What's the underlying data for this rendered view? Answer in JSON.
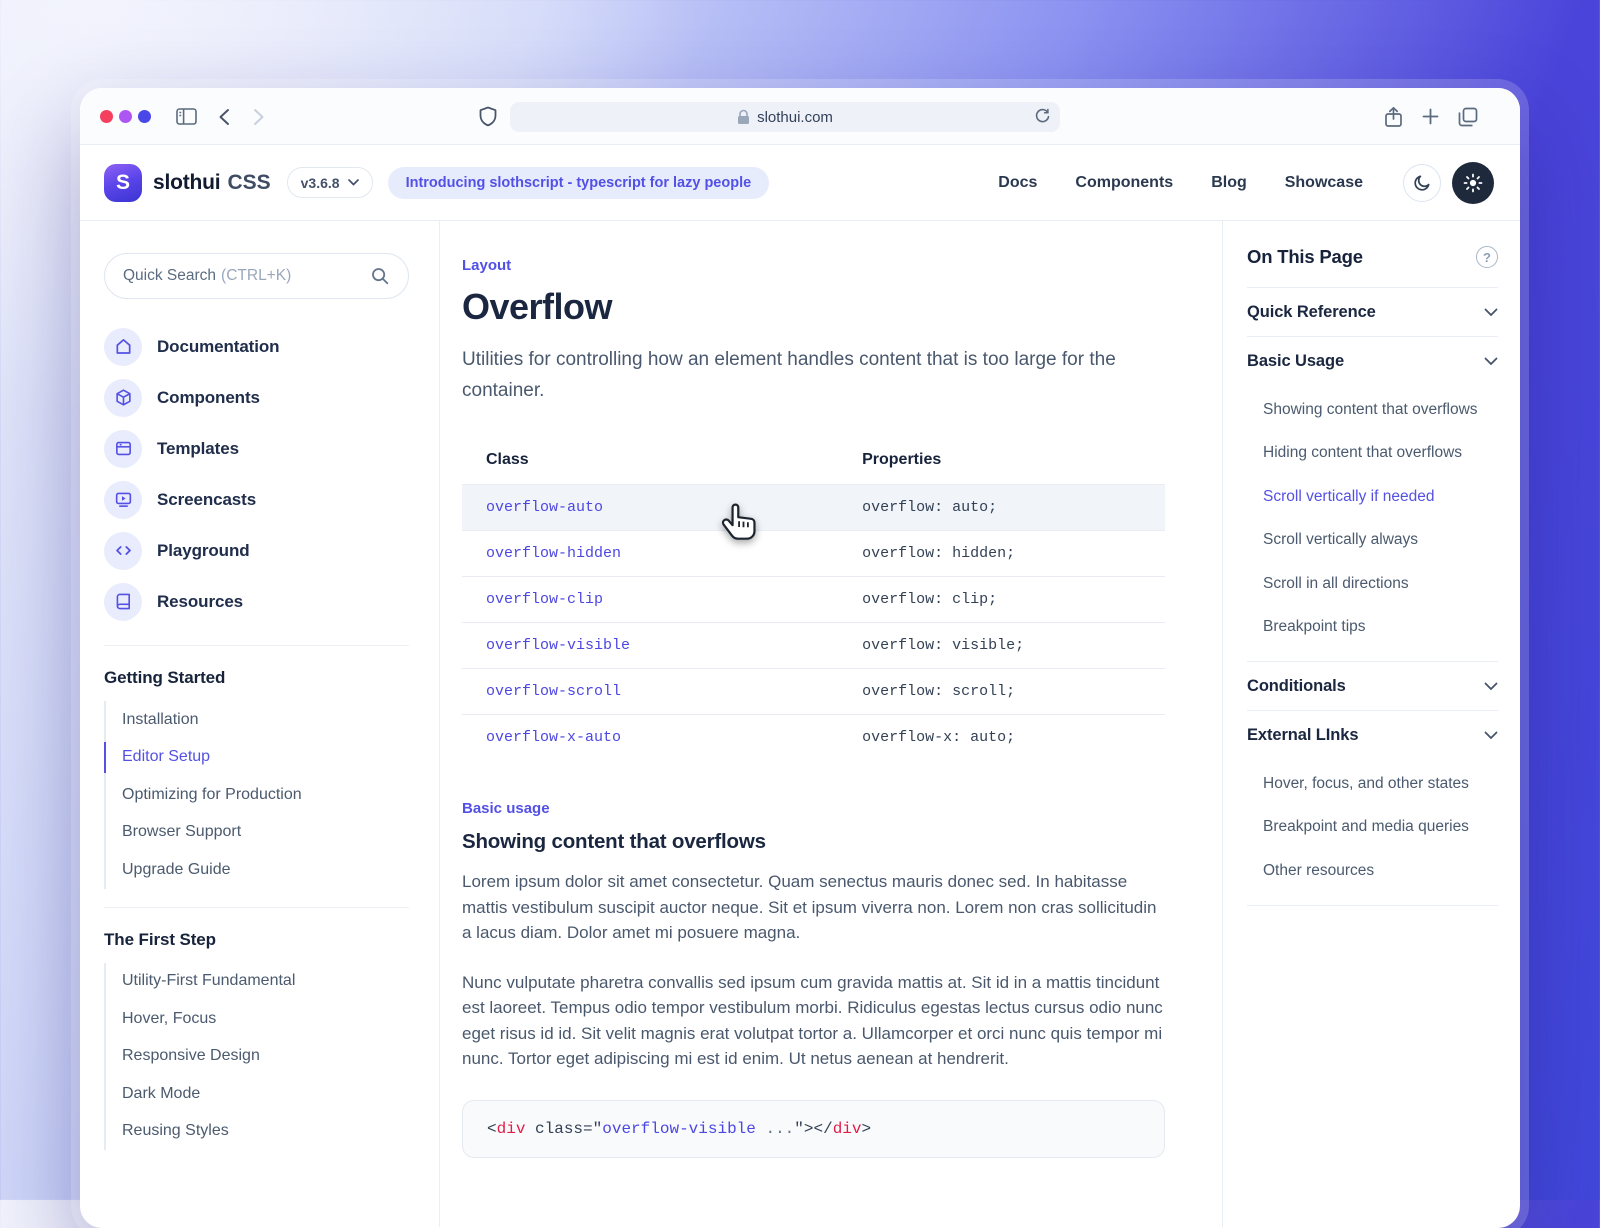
{
  "browser": {
    "url": "slothui.com"
  },
  "navbar": {
    "brand": "slothui",
    "brand_suffix": "CSS",
    "logo_letter": "S",
    "version": "v3.6.8",
    "announcement": "Introducing slothscript - typescript for lazy people",
    "links": {
      "docs": "Docs",
      "components": "Components",
      "blog": "Blog",
      "showcase": "Showcase"
    }
  },
  "sidebar": {
    "search": {
      "label": "Quick Search",
      "shortcut": "(CTRL+K)"
    },
    "nav": [
      {
        "label": "Documentation",
        "icon": "home-icon"
      },
      {
        "label": "Components",
        "icon": "cube-icon"
      },
      {
        "label": "Templates",
        "icon": "browser-window-icon"
      },
      {
        "label": "Screencasts",
        "icon": "screencast-icon"
      },
      {
        "label": "Playground",
        "icon": "code-icon"
      },
      {
        "label": "Resources",
        "icon": "book-icon"
      }
    ],
    "sections": [
      {
        "title": "Getting Started",
        "items": [
          "Installation",
          "Editor Setup",
          "Optimizing for Production",
          "Browser Support",
          "Upgrade Guide"
        ],
        "active_item": "Editor Setup"
      },
      {
        "title": "The First Step",
        "items": [
          "Utility-First Fundamental",
          "Hover, Focus",
          "Responsive Design",
          "Dark Mode",
          "Reusing Styles"
        ]
      }
    ]
  },
  "main": {
    "eyebrow": "Layout",
    "title": "Overflow",
    "description": "Utilities for controlling how an element handles content that is too large for the container.",
    "table": {
      "col_class": "Class",
      "col_props": "Properties",
      "rows": [
        {
          "cls": "overflow-auto",
          "props": "overflow: auto;"
        },
        {
          "cls": "overflow-hidden",
          "props": "overflow: hidden;"
        },
        {
          "cls": "overflow-clip",
          "props": "overflow: clip;"
        },
        {
          "cls": "overflow-visible",
          "props": "overflow: visible;"
        },
        {
          "cls": "overflow-scroll",
          "props": "overflow: scroll;"
        },
        {
          "cls": "overflow-x-auto",
          "props": "overflow-x: auto;"
        }
      ],
      "hovered_row": "overflow-auto"
    },
    "usage": {
      "eyebrow": "Basic usage",
      "title": "Showing content that overflows",
      "p1": "Lorem ipsum dolor sit amet consectetur. Quam senectus mauris donec sed. In habitasse mattis vestibulum suscipit auctor neque. Sit et ipsum viverra non. Lorem non cras sollicitudin a lacus diam. Dolor amet mi posuere magna.",
      "p2": "Nunc vulputate pharetra convallis sed ipsum cum gravida mattis at. Sit id in a mattis tincidunt est laoreet. Tempus odio tempor vestibulum morbi. Ridiculus egestas lectus cursus odio nunc eget risus id id. Sit velit magnis erat volutpat tortor a. Ullamcorper et orci nunc quis tempor mi nunc. Tortor eget adipiscing mi est id enim. Ut netus aenean at hendrerit."
    },
    "code": {
      "lt": "<",
      "tag": "div",
      "attr": " class=",
      "q": "\"",
      "val": "overflow-visible",
      "dots": " ...",
      "qgt": "\">",
      "clt": "</",
      "ctag": "div",
      "gt": ">"
    }
  },
  "toc": {
    "title": "On This Page",
    "quick_reference": "Quick Reference",
    "basic_usage": "Basic Usage",
    "basic_items": [
      "Showing content that overflows",
      "Hiding content that overflows",
      "Scroll vertically if needed",
      "Scroll vertically always",
      "Scroll in all directions",
      "Breakpoint tips"
    ],
    "active_item": "Scroll vertically if needed",
    "conditionals": "Conditionals",
    "external": "External LInks",
    "external_items": [
      "Hover, focus, and other states",
      "Breakpoint and media queries",
      "Other resources"
    ]
  },
  "colors": {
    "accent": "#5451e4",
    "accent_soft": "#e9ecfc",
    "heading": "#1b2740",
    "body": "#4a586d",
    "border": "#e9edf4",
    "row_highlight": "#f1f4f9",
    "code_red": "#e11d48",
    "dark_button": "#1e293b",
    "traffic_red": "#f43f5e",
    "traffic_purple": "#ad56f3",
    "traffic_blue": "#4a47e9"
  }
}
